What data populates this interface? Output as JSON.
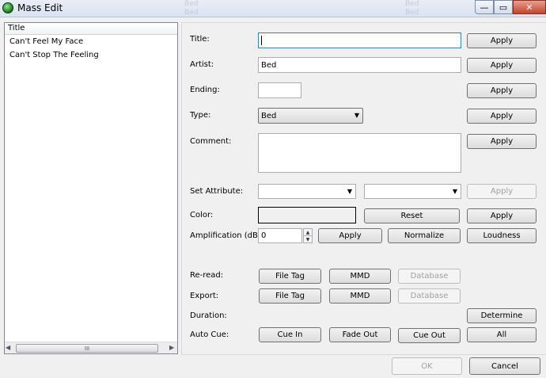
{
  "window": {
    "title": "Mass Edit",
    "ghost_texts": [
      "Bed",
      "Bed",
      "Bed",
      "Bed"
    ],
    "controls": {
      "minimize": "—",
      "maximize": "▭",
      "close": "✕"
    }
  },
  "list": {
    "column_header": "Title",
    "items": [
      "Can't Feel My Face",
      "Can't Stop The Feeling"
    ],
    "scroll": {
      "left": "◀",
      "right": "▶",
      "thumb": "III"
    }
  },
  "form": {
    "title": {
      "label": "Title:",
      "value": "",
      "apply": "Apply"
    },
    "artist": {
      "label": "Artist:",
      "value": "Bed",
      "apply": "Apply"
    },
    "ending": {
      "label": "Ending:",
      "value": "",
      "apply": "Apply"
    },
    "type": {
      "label": "Type:",
      "value": "Bed",
      "apply": "Apply"
    },
    "comment": {
      "label": "Comment:",
      "value": "",
      "apply": "Apply"
    },
    "set_attribute": {
      "label": "Set Attribute:",
      "value1": "",
      "value2": "",
      "apply": "Apply"
    },
    "color": {
      "label": "Color:",
      "reset": "Reset",
      "apply": "Apply"
    },
    "amplification": {
      "label": "Amplification (dB):",
      "value": "0",
      "apply": "Apply",
      "normalize": "Normalize",
      "loudness": "Loudness"
    },
    "reread": {
      "label": "Re-read:",
      "file_tag": "File Tag",
      "mmd": "MMD",
      "database": "Database"
    },
    "export": {
      "label": "Export:",
      "file_tag": "File Tag",
      "mmd": "MMD",
      "database": "Database"
    },
    "duration": {
      "label": "Duration:",
      "determine": "Determine"
    },
    "auto_cue": {
      "label": "Auto Cue:",
      "cue_in": "Cue In",
      "fade_out": "Fade Out",
      "cue_out": "Cue Out",
      "all": "All"
    }
  },
  "footer": {
    "ok": "OK",
    "cancel": "Cancel"
  }
}
